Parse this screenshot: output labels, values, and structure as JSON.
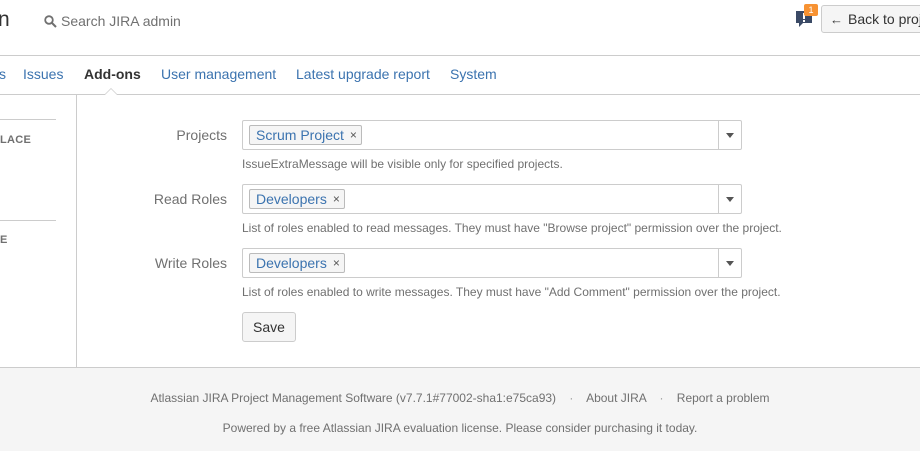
{
  "header": {
    "brand_fragment": "n",
    "search_label": "Search JIRA admin",
    "notification_count": "1",
    "back_button_label": "Back to project"
  },
  "tabs": [
    {
      "label": "s"
    },
    {
      "label": "Issues"
    },
    {
      "label": "Add-ons"
    },
    {
      "label": "User management"
    },
    {
      "label": "Latest upgrade report"
    },
    {
      "label": "System"
    }
  ],
  "sidebar": {
    "heading_1": "LACE",
    "heading_2": "E"
  },
  "form": {
    "projects": {
      "label": "Projects",
      "token": "Scrum Project",
      "help": "IssueExtraMessage will be visible only for specified projects."
    },
    "read_roles": {
      "label": "Read Roles",
      "token": "Developers",
      "help": "List of roles enabled to read messages. They must have \"Browse project\" permission over the project."
    },
    "write_roles": {
      "label": "Write Roles",
      "token": "Developers",
      "help": "List of roles enabled to write messages. They must have \"Add Comment\" permission over the project."
    },
    "remove_glyph": "×",
    "save_label": "Save"
  },
  "footer": {
    "version_text": "Atlassian JIRA Project Management Software (v7.7.1#77002-sha1:e75ca93)",
    "separator": "·",
    "about_label": "About JIRA",
    "report_label": "Report a problem",
    "license_text": "Powered by a free Atlassian JIRA evaluation license. Please consider purchasing it today."
  },
  "colors": {
    "link": "#3b73af",
    "badge": "#f79232",
    "border": "#cccccc",
    "footer_bg": "#f5f5f5"
  },
  "icons": {
    "search": "search-icon",
    "notification": "feedback-icon",
    "back": "arrow-left-icon",
    "dropdown": "chevron-down-icon",
    "remove": "close-icon"
  }
}
